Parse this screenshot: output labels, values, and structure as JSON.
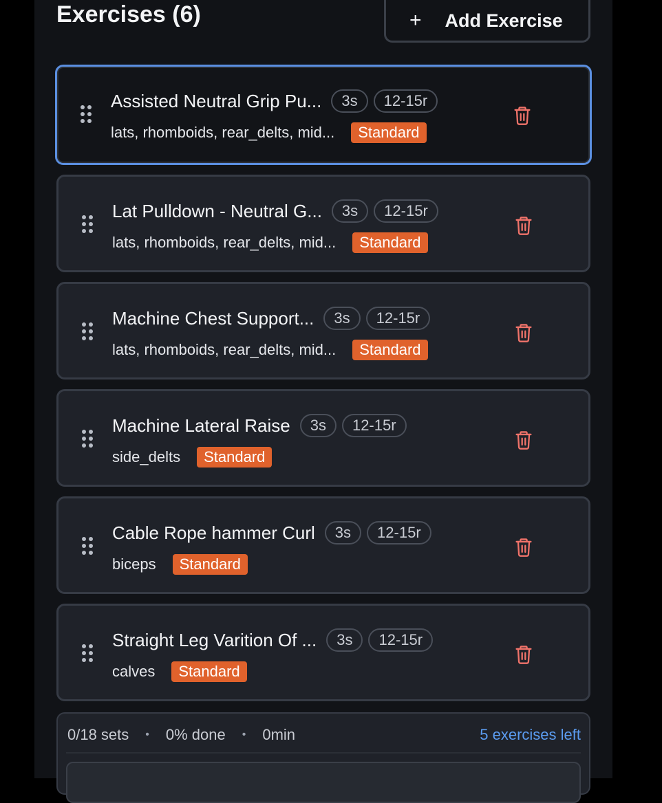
{
  "header": {
    "title": "Exercises (6)",
    "add_label": "Add Exercise",
    "add_icon": "+"
  },
  "exercises": [
    {
      "name": "Assisted Neutral Grip Pu...",
      "sets": "3s",
      "reps": "12-15r",
      "muscles": "lats, rhomboids, rear_delts, mid...",
      "tag": "Standard",
      "selected": true
    },
    {
      "name": "Lat Pulldown - Neutral G...",
      "sets": "3s",
      "reps": "12-15r",
      "muscles": "lats, rhomboids, rear_delts, mid...",
      "tag": "Standard",
      "selected": false
    },
    {
      "name": "Machine Chest Support...",
      "sets": "3s",
      "reps": "12-15r",
      "muscles": "lats, rhomboids, rear_delts, mid...",
      "tag": "Standard",
      "selected": false
    },
    {
      "name": "Machine Lateral Raise",
      "sets": "3s",
      "reps": "12-15r",
      "muscles": "side_delts",
      "tag": "Standard",
      "selected": false
    },
    {
      "name": "Cable Rope hammer Curl",
      "sets": "3s",
      "reps": "12-15r",
      "muscles": "biceps",
      "tag": "Standard",
      "selected": false
    },
    {
      "name": "Straight Leg Varition Of ...",
      "sets": "3s",
      "reps": "12-15r",
      "muscles": "calves",
      "tag": "Standard",
      "selected": false
    }
  ],
  "footer": {
    "sets": "0/18 sets",
    "done": "0% done",
    "time": "0min",
    "separator": "•",
    "remaining": "5 exercises left"
  },
  "icons": {
    "drag": "drag-handle-icon",
    "delete": "trash-icon",
    "add": "plus-icon"
  },
  "colors": {
    "accent": "#5b8fe0",
    "badge": "#e0622c",
    "danger": "#f0736a",
    "link": "#5b9cf0"
  }
}
